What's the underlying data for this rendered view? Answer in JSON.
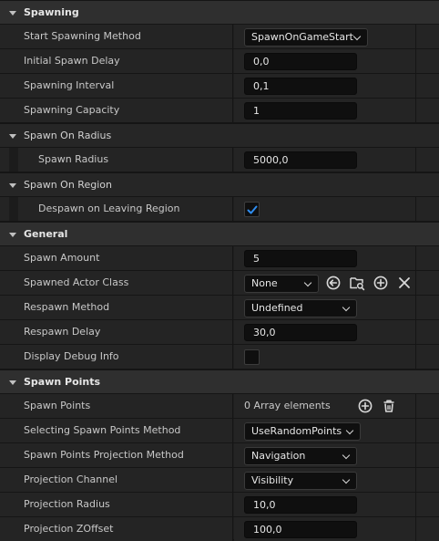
{
  "categories": {
    "spawning": "Spawning",
    "spawn_on_radius": "Spawn On Radius",
    "spawn_on_region": "Spawn On Region",
    "general": "General",
    "spawn_points": "Spawn Points"
  },
  "props": {
    "start_spawning_method": {
      "label": "Start Spawning Method",
      "value": "SpawnOnGameStart"
    },
    "initial_spawn_delay": {
      "label": "Initial Spawn Delay",
      "value": "0,0"
    },
    "spawning_interval": {
      "label": "Spawning Interval",
      "value": "0,1"
    },
    "spawning_capacity": {
      "label": "Spawning Capacity",
      "value": "1"
    },
    "spawn_radius": {
      "label": "Spawn Radius",
      "value": "5000,0"
    },
    "despawn_on_leaving_region": {
      "label": "Despawn on Leaving Region",
      "checked": true
    },
    "spawn_amount": {
      "label": "Spawn Amount",
      "value": "5"
    },
    "spawned_actor_class": {
      "label": "Spawned Actor Class",
      "value": "None"
    },
    "respawn_method": {
      "label": "Respawn Method",
      "value": "Undefined"
    },
    "respawn_delay": {
      "label": "Respawn Delay",
      "value": "30,0"
    },
    "display_debug_info": {
      "label": "Display Debug Info",
      "checked": false
    },
    "spawn_points": {
      "label": "Spawn Points",
      "value": "0 Array elements"
    },
    "selecting_spawn_points_method": {
      "label": "Selecting Spawn Points Method",
      "value": "UseRandomPoints"
    },
    "spawn_points_projection_method": {
      "label": "Spawn Points Projection Method",
      "value": "Navigation"
    },
    "projection_channel": {
      "label": "Projection Channel",
      "value": "Visibility"
    },
    "projection_radius": {
      "label": "Projection Radius",
      "value": "10,0"
    },
    "projection_zoffset": {
      "label": "Projection ZOffset",
      "value": "100,0"
    }
  },
  "icons": {
    "use_selected": "arrow-left-circle-icon",
    "browse": "folder-search-icon",
    "add": "plus-circle-icon",
    "clear": "close-icon",
    "array_add": "plus-circle-icon",
    "array_clear": "trash-icon"
  },
  "colors": {
    "accent": "#1e7ad6",
    "check": "#2f8df0"
  }
}
